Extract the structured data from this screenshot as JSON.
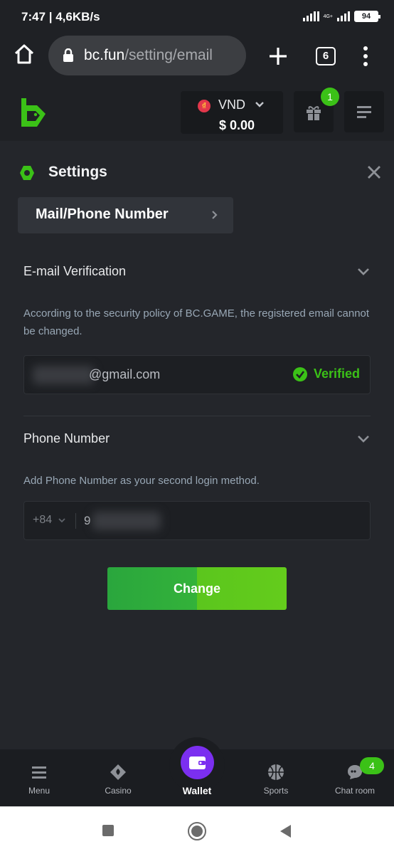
{
  "status_bar": {
    "time_speed": "7:47 | 4,6KB/s",
    "network": "4G+",
    "battery": "94"
  },
  "browser": {
    "url_host": "bc.fun",
    "url_path": "/setting/email",
    "tab_count": "6"
  },
  "header": {
    "currency": "VND",
    "currency_symbol": "₫",
    "balance": "$ 0.00",
    "gift_badge": "1",
    "accent_color": "#3bc117"
  },
  "settings": {
    "title": "Settings",
    "subnav_label": "Mail/Phone Number",
    "email_section": {
      "title": "E-mail Verification",
      "description": "According to the security policy of BC.GAME, the registered email cannot be changed.",
      "email_domain": "@gmail.com",
      "status": "Verified"
    },
    "phone_section": {
      "title": "Phone Number",
      "description": "Add Phone Number as your second login method.",
      "country_code": "+84",
      "phone_first_digit": "9"
    },
    "change_button": "Change"
  },
  "bottom_nav": {
    "items": [
      {
        "label": "Menu",
        "icon": "menu-icon"
      },
      {
        "label": "Casino",
        "icon": "casino-icon"
      },
      {
        "label": "Wallet",
        "icon": "wallet-icon"
      },
      {
        "label": "Sports",
        "icon": "sports-icon"
      },
      {
        "label": "Chat room",
        "icon": "chat-icon"
      }
    ],
    "chat_badge": "4"
  }
}
